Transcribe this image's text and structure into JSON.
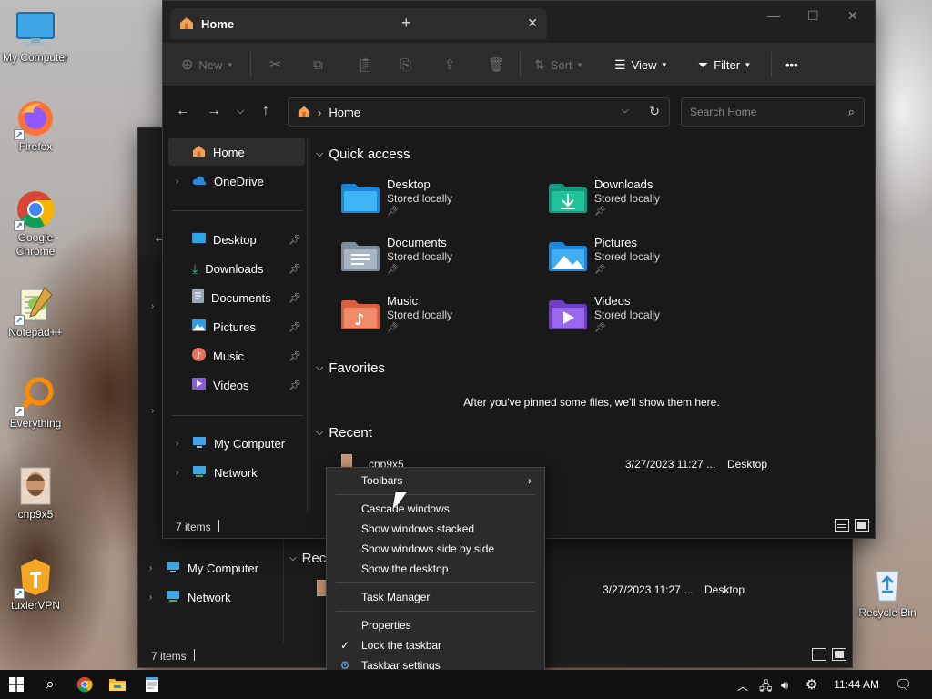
{
  "desktop": {
    "icons": [
      {
        "label": "My Computer"
      },
      {
        "label": "Firefox"
      },
      {
        "label": "Google Chrome"
      },
      {
        "label": "Notepad++"
      },
      {
        "label": "Everything"
      },
      {
        "label": "cnp9x5"
      },
      {
        "label": "tuxlerVPN"
      },
      {
        "label": "Recycle Bin"
      }
    ]
  },
  "explorer": {
    "tab_title": "Home",
    "toolbar": {
      "new": "New",
      "sort": "Sort",
      "view": "View",
      "filter": "Filter",
      "more": "•••"
    },
    "address": "Home",
    "search_placeholder": "Search Home",
    "sidebar": {
      "home": "Home",
      "onedrive": "OneDrive",
      "desktop": "Desktop",
      "downloads": "Downloads",
      "documents": "Documents",
      "pictures": "Pictures",
      "music": "Music",
      "videos": "Videos",
      "my_computer": "My Computer",
      "network": "Network"
    },
    "sections": {
      "quick_access": "Quick access",
      "favorites": "Favorites",
      "recent": "Recent"
    },
    "quick_access": [
      {
        "name": "Desktop",
        "sub": "Stored locally"
      },
      {
        "name": "Downloads",
        "sub": "Stored locally"
      },
      {
        "name": "Documents",
        "sub": "Stored locally"
      },
      {
        "name": "Pictures",
        "sub": "Stored locally"
      },
      {
        "name": "Music",
        "sub": "Stored locally"
      },
      {
        "name": "Videos",
        "sub": "Stored locally"
      }
    ],
    "favorites_empty": "After you've pinned some files, we'll show them here.",
    "recent": [
      {
        "name": "cnp9x5",
        "date": "3/27/2023 11:27 ...",
        "location": "Desktop"
      }
    ],
    "status_count": "7 items"
  },
  "back_window": {
    "recent_label": "Rec",
    "my_computer": "My Computer",
    "network": "Network",
    "date": "3/27/2023 11:27 ...",
    "location": "Desktop",
    "status_count": "7 items"
  },
  "context_menu": {
    "toolbars": "Toolbars",
    "cascade": "Cascade windows",
    "stacked": "Show windows stacked",
    "side_by_side": "Show windows side by side",
    "show_desktop": "Show the desktop",
    "task_manager": "Task Manager",
    "properties": "Properties",
    "lock_taskbar": "Lock the taskbar",
    "taskbar_settings": "Taskbar settings"
  },
  "taskbar": {
    "time": "11:44 AM"
  },
  "colors": {
    "window_bg": "#191919",
    "toolbar_bg": "#2c2c2c",
    "menu_bg": "#2b2b2b",
    "taskbar_bg": "#101010",
    "accent_blue": "#1e90ff",
    "folder_orange": "#f5a623"
  }
}
